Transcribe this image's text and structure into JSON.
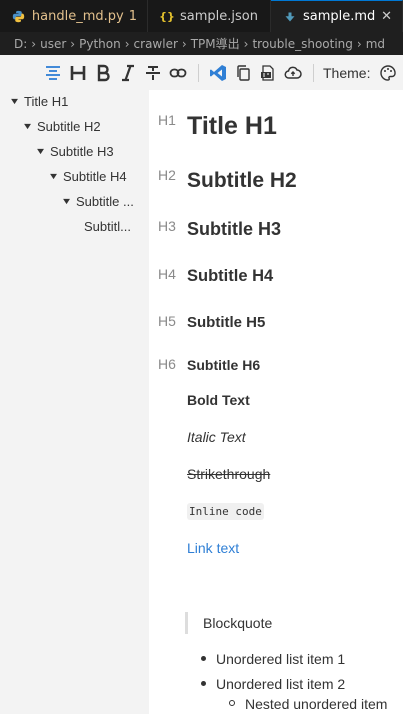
{
  "tabs": [
    {
      "icon": "python-file-icon",
      "label": "handle_md.py",
      "badge": "1"
    },
    {
      "icon": "json-file-icon",
      "label": "sample.json"
    },
    {
      "icon": "markdown-file-icon",
      "label": "sample.md"
    }
  ],
  "breadcrumb": [
    "D:",
    "user",
    "Python",
    "crawler",
    "TPM導出",
    "trouble_shooting",
    "md"
  ],
  "toolbar": {
    "icons": [
      "outline-toggle-icon",
      "heading-icon",
      "bold-icon",
      "italic-icon",
      "strikethrough-icon",
      "link-icon",
      "vscode-icon",
      "copy-icon",
      "export-icon",
      "cloud-icon"
    ],
    "theme_label": "Theme:"
  },
  "outline": [
    {
      "label": "Title H1"
    },
    {
      "label": "Subtitle H2"
    },
    {
      "label": "Subtitle H3"
    },
    {
      "label": "Subtitle H4"
    },
    {
      "label": "Subtitle ..."
    },
    {
      "label": "Subtitl..."
    }
  ],
  "content": {
    "headings": [
      {
        "marker": "H1",
        "text": "Title H1"
      },
      {
        "marker": "H2",
        "text": "Subtitle H2"
      },
      {
        "marker": "H3",
        "text": "Subtitle H3"
      },
      {
        "marker": "H4",
        "text": "Subtitle H4"
      },
      {
        "marker": "H5",
        "text": "Subtitle H5"
      },
      {
        "marker": "H6",
        "text": "Subtitle H6"
      }
    ],
    "bold": "Bold Text",
    "italic": "Italic Text",
    "strike": "Strikethrough",
    "code": "Inline code",
    "link": "Link text",
    "blockquote": "Blockquote",
    "list": [
      "Unordered list item 1",
      "Unordered list item 2"
    ],
    "nested": [
      "Nested unordered item"
    ]
  }
}
